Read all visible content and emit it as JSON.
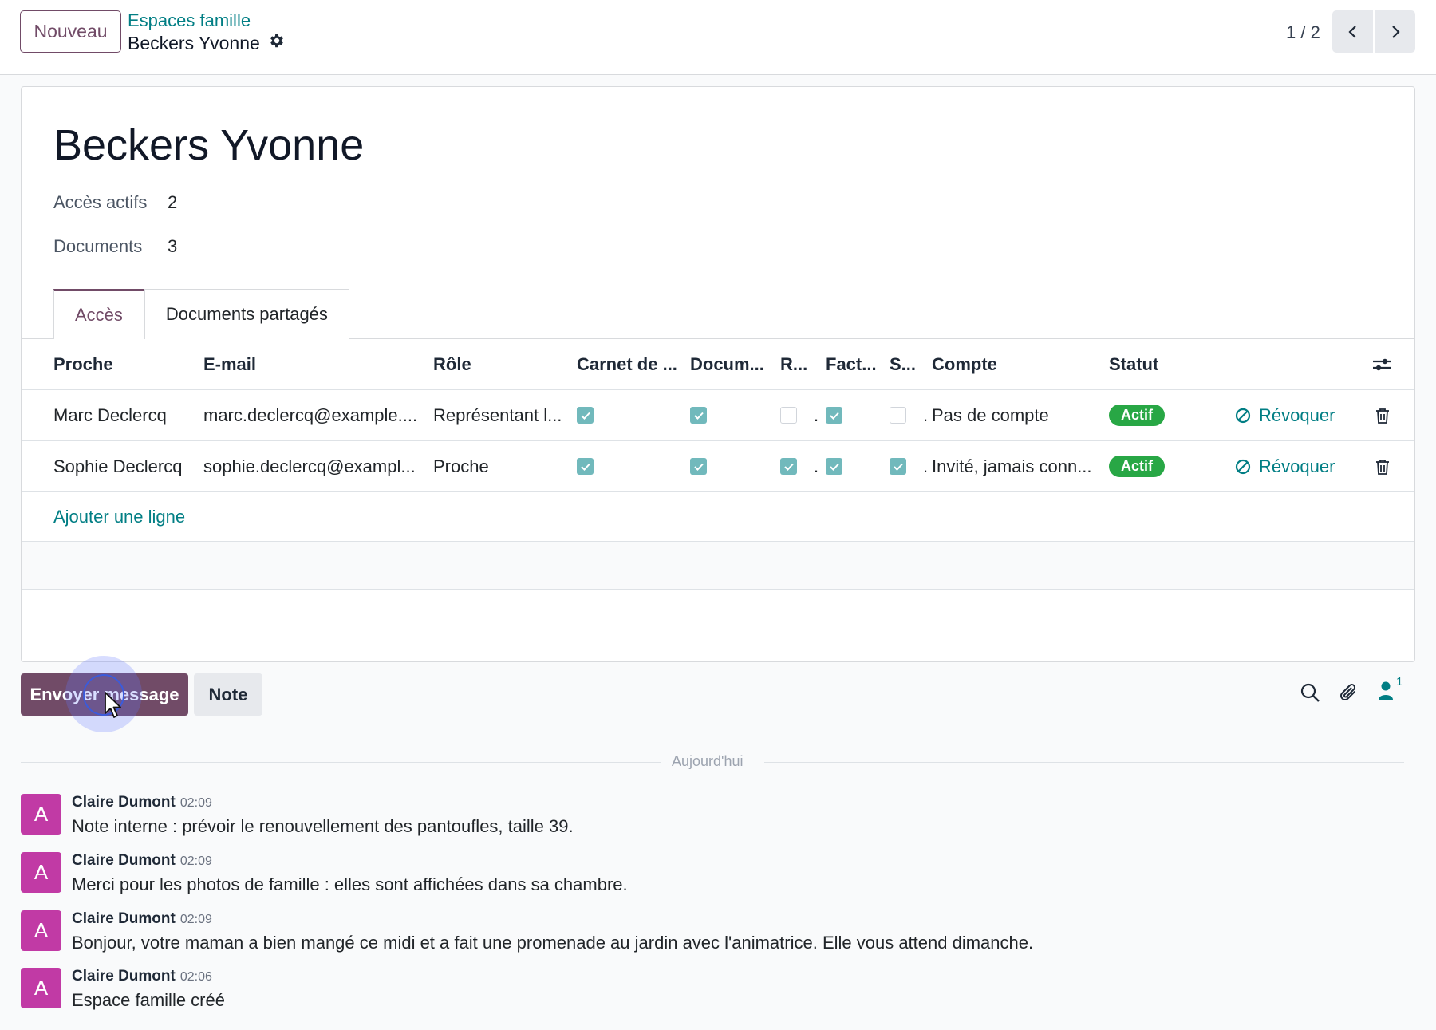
{
  "control_panel": {
    "new_label": "Nouveau",
    "breadcrumb_parent": "Espaces famille",
    "breadcrumb_current": "Beckers Yvonne",
    "pager": "1 / 2"
  },
  "record": {
    "title": "Beckers Yvonne",
    "fields": [
      {
        "label": "Accès actifs",
        "value": "2"
      },
      {
        "label": "Documents",
        "value": "3"
      }
    ]
  },
  "tabs": [
    {
      "label": "Accès",
      "active": true
    },
    {
      "label": "Documents partagés",
      "active": false
    }
  ],
  "table": {
    "headers": {
      "proche": "Proche",
      "email": "E-mail",
      "role": "Rôle",
      "carnet": "Carnet de ...",
      "docum": "Docum...",
      "r": "R...",
      "fact": "Fact...",
      "s": "S...",
      "compte": "Compte",
      "statut": "Statut"
    },
    "rows": [
      {
        "proche": "Marc Declercq",
        "email": "marc.declercq@example....",
        "role": "Représentant l...",
        "carnet": true,
        "docum": true,
        "r": false,
        "fact": true,
        "s": false,
        "compte": "Pas de compte",
        "statut": "Actif",
        "revoke": "Révoquer"
      },
      {
        "proche": "Sophie Declercq",
        "email": "sophie.declercq@exampl...",
        "role": "Proche",
        "carnet": true,
        "docum": true,
        "r": true,
        "fact": true,
        "s": true,
        "compte": "Invité, jamais conn...",
        "statut": "Actif",
        "revoke": "Révoquer"
      }
    ],
    "add_line": "Ajouter une ligne"
  },
  "chatter": {
    "send_label": "Envoyer message",
    "note_label": "Note",
    "followers_count": "1",
    "date_divider": "Aujourd'hui",
    "messages": [
      {
        "avatar": "A",
        "author": "Claire Dumont",
        "time": "02:09",
        "body": "Note interne : prévoir le renouvellement des pantoufles, taille 39."
      },
      {
        "avatar": "A",
        "author": "Claire Dumont",
        "time": "02:09",
        "body": "Merci pour les photos de famille : elles sont affichées dans sa chambre."
      },
      {
        "avatar": "A",
        "author": "Claire Dumont",
        "time": "02:09",
        "body": "Bonjour, votre maman a bien mangé ce midi et a fait une promenade au jardin avec l'animatrice. Elle vous attend dimanche."
      },
      {
        "avatar": "A",
        "author": "Claire Dumont",
        "time": "02:06",
        "body": "Espace famille créé"
      }
    ]
  },
  "colors": {
    "brand": "#714b67",
    "link": "#017e84",
    "checkbox": "#71b9bc",
    "badge_success": "#28a745",
    "avatar": "#c13aa5"
  }
}
